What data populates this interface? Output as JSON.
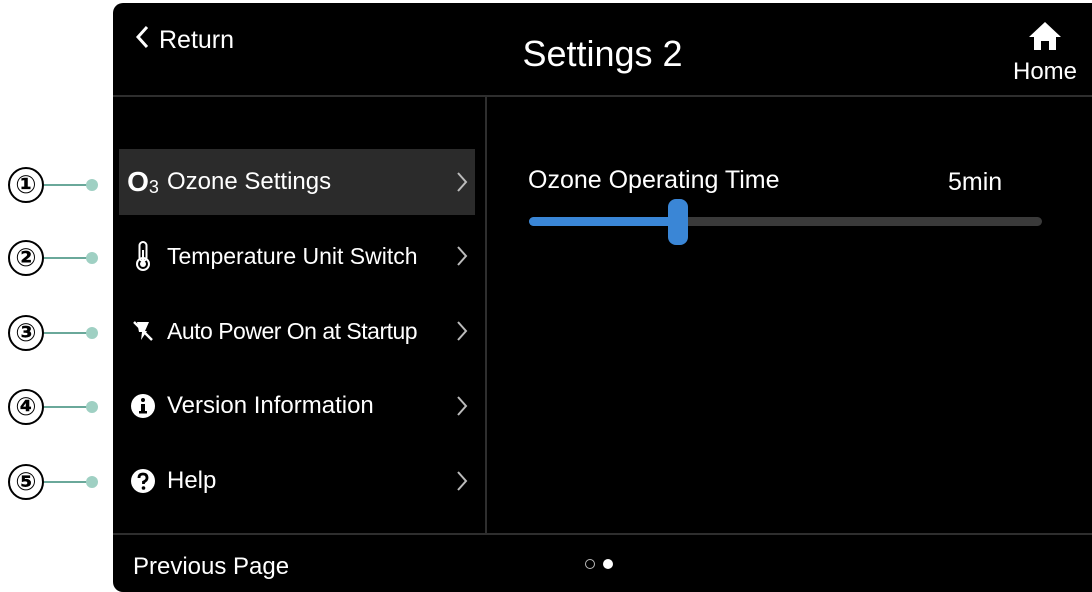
{
  "header": {
    "return_label": "Return",
    "title": "Settings 2",
    "home_label": "Home"
  },
  "callouts": [
    "①",
    "②",
    "③",
    "④",
    "⑤"
  ],
  "menu": {
    "items": [
      {
        "icon_text": "O",
        "icon_sub": "3",
        "label": "Ozone Settings",
        "icon": "ozone-icon",
        "active": true
      },
      {
        "label": "Temperature Unit Switch",
        "icon": "thermometer-icon"
      },
      {
        "label": "Auto Power On at Startup",
        "icon": "power-plug-icon"
      },
      {
        "label": "Version Information",
        "icon": "info-icon"
      },
      {
        "label": "Help",
        "icon": "help-icon"
      }
    ]
  },
  "content": {
    "setting_label": "Ozone Operating Time",
    "setting_value": "5min",
    "slider_fraction": 0.29
  },
  "footer": {
    "prev_label": "Previous Page",
    "pages": 2,
    "current_page": 2
  },
  "colors": {
    "accent": "#3a86d6",
    "background": "#000000",
    "active_item": "#2b2b2b",
    "callout_line": "#6aa89a"
  }
}
